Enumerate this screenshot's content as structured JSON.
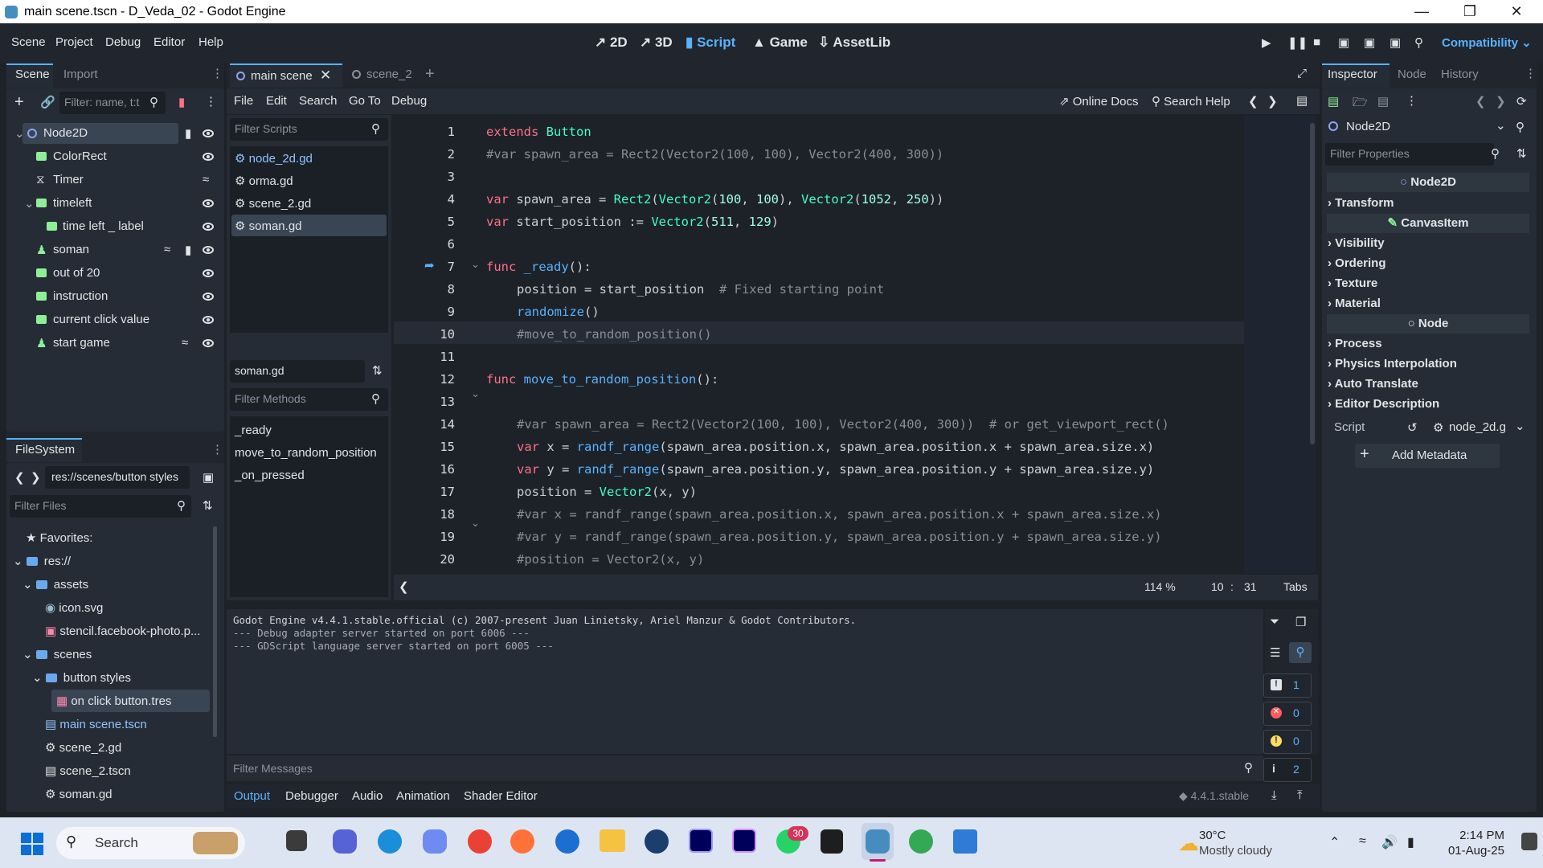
{
  "window": {
    "title": "main scene.tscn - D_Veda_02 - Godot Engine"
  },
  "menus": [
    "Scene",
    "Project",
    "Debug",
    "Editor",
    "Help"
  ],
  "workspaces": [
    "2D",
    "3D",
    "Script",
    "Game",
    "AssetLib"
  ],
  "active_workspace": "Script",
  "renderer": "Compatibility",
  "scene_dock": {
    "tabs": [
      "Scene",
      "Import"
    ],
    "filter_placeholder": "Filter: name, t:t",
    "nodes": [
      {
        "label": "Node2D",
        "icon": "node2d-icon"
      },
      {
        "label": "ColorRect",
        "icon": "colorrect-icon"
      },
      {
        "label": "Timer",
        "icon": "timer-icon"
      },
      {
        "label": "timeleft",
        "icon": "label-icon"
      },
      {
        "label": "time left _ label",
        "icon": "label-icon"
      },
      {
        "label": "soman",
        "icon": "button-icon"
      },
      {
        "label": "out of 20",
        "icon": "label-icon"
      },
      {
        "label": "instruction",
        "icon": "label-icon"
      },
      {
        "label": "current click value",
        "icon": "label-icon"
      },
      {
        "label": "start game",
        "icon": "button-icon"
      }
    ]
  },
  "filesystem": {
    "tab": "FileSystem",
    "path": "res://scenes/button styles",
    "filter_placeholder": "Filter Files",
    "items": [
      "Favorites:",
      "res://",
      "assets",
      "icon.svg",
      "stencil.facebook-photo.p...",
      "scenes",
      "button styles",
      "on click button.tres",
      "main scene.tscn",
      "scene_2.gd",
      "scene_2.tscn",
      "soman.gd"
    ]
  },
  "scene_tabs": [
    "main scene",
    "scene_2"
  ],
  "script_menu": [
    "File",
    "Edit",
    "Search",
    "Go To",
    "Debug"
  ],
  "online_docs": "Online Docs",
  "search_help": "Search Help",
  "scripts_panel": {
    "filter_placeholder": "Filter Scripts",
    "scripts": [
      "node_2d.gd",
      "orma.gd",
      "scene_2.gd",
      "soman.gd"
    ],
    "current": "soman.gd",
    "methods_placeholder": "Filter Methods",
    "methods": [
      "_ready",
      "move_to_random_position",
      "_on_pressed"
    ]
  },
  "code": {
    "line_numbers": [
      "1",
      "2",
      "3",
      "4",
      "5",
      "6",
      "7",
      "8",
      "9",
      "10",
      "11",
      "12",
      "13",
      "14",
      "15",
      "16",
      "17",
      "18",
      "19",
      "20"
    ],
    "l1a": "extends",
    "l1b": "Button",
    "l2": "#var spawn_area = Rect2(Vector2(100, 100), Vector2(400, 300))",
    "l4a": "var",
    "l4b": " spawn_area = ",
    "l4c": "Rect2",
    "l4d": "(",
    "l4e": "Vector2",
    "l4f": "(",
    "l4g": "100",
    "l4h": ", ",
    "l4i": "100",
    "l4j": "), ",
    "l4k": "Vector2",
    "l4l": "(",
    "l4m": "1052",
    "l4n": ", ",
    "l4o": "250",
    "l4p": "))",
    "l5a": "var",
    "l5b": " start_position := ",
    "l5c": "Vector2",
    "l5d": "(",
    "l5e": "511",
    "l5f": ", ",
    "l5g": "129",
    "l5h": ")",
    "l7a": "func",
    "l7b": " _ready",
    "l7c": "():",
    "l8a": "position = start_position  ",
    "l8b": "# Fixed starting point",
    "l9a": "randomize",
    "l9b": "()",
    "l10": "#move_to_random_position()",
    "l12a": "func",
    "l12b": " move_to_random_position",
    "l12c": "():",
    "l14": "#var spawn_area = Rect2(Vector2(100, 100), Vector2(400, 300))  # or get_viewport_rect()",
    "l15a": "var",
    "l15b": " x = ",
    "l15c": "randf_range",
    "l15d": "(spawn_area.position.x, spawn_area.position.x + spawn_area.size.x)",
    "l16a": "var",
    "l16b": " y = ",
    "l16c": "randf_range",
    "l16d": "(spawn_area.position.y, spawn_area.position.y + spawn_area.size.y)",
    "l17a": "position = ",
    "l17b": "Vector2",
    "l17c": "(x, y)",
    "l18": "#var x = randf_range(spawn_area.position.x, spawn_area.position.x + spawn_area.size.x)",
    "l19": "#var y = randf_range(spawn_area.position.y, spawn_area.position.y + spawn_area.size.y)",
    "l20": "#position = Vector2(x, y)"
  },
  "editor_status": {
    "zoom": "114 %",
    "line": "10",
    "col": "31",
    "indent": "Tabs"
  },
  "output": {
    "lines": [
      "Godot Engine v4.4.1.stable.official (c) 2007-present Juan Linietsky, Ariel Manzur & Godot Contributors.",
      "--- Debug adapter server started on port 6006 ---",
      "--- GDScript language server started on port 6005 ---"
    ],
    "counts": [
      "1",
      "0",
      "0",
      "2"
    ],
    "filter_placeholder": "Filter Messages"
  },
  "bottom_tabs": [
    "Output",
    "Debugger",
    "Audio",
    "Animation",
    "Shader Editor"
  ],
  "version": "4.4.1.stable",
  "inspector": {
    "tabs": [
      "Inspector",
      "Node",
      "History"
    ],
    "object": "Node2D",
    "filter_placeholder": "Filter Properties",
    "sections": [
      {
        "header": "Node2D",
        "cats": [
          "Transform"
        ]
      },
      {
        "header": "CanvasItem",
        "cats": [
          "Visibility",
          "Ordering",
          "Texture",
          "Material"
        ]
      },
      {
        "header": "Node",
        "cats": [
          "Process",
          "Physics Interpolation",
          "Auto Translate",
          "Editor Description"
        ]
      }
    ],
    "script_label": "Script",
    "script_value": "node_2d.g",
    "add_metadata": "Add Metadata"
  },
  "taskbar": {
    "search": "Search",
    "weather_temp": "30°C",
    "weather_desc": "Mostly cloudy",
    "time": "2:14 PM",
    "date": "01-Aug-25",
    "whatsapp_badge": "30"
  },
  "colors": {
    "accent": "#57b3ff",
    "keyword": "#ff7085",
    "class": "#42ffc2",
    "number": "#a1ffe0",
    "comment": "#888e96"
  }
}
